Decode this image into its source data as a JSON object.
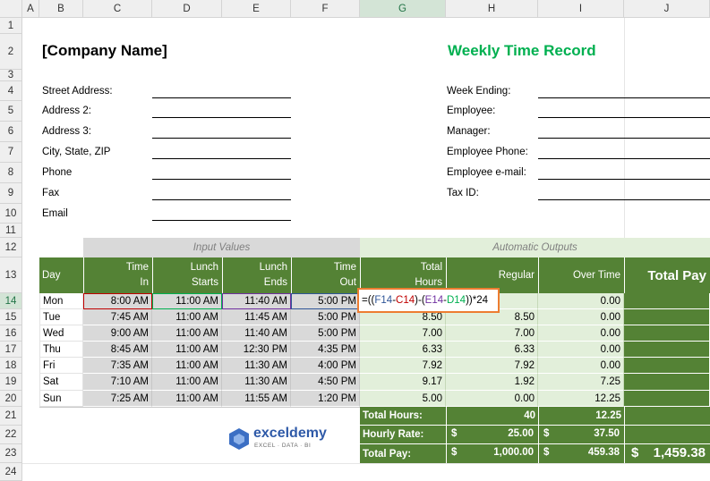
{
  "columns": [
    "A",
    "B",
    "C",
    "D",
    "E",
    "F",
    "G",
    "H",
    "I",
    "J"
  ],
  "rows": [
    "1",
    "2",
    "3",
    "4",
    "5",
    "6",
    "7",
    "8",
    "9",
    "10",
    "11",
    "12",
    "13",
    "14",
    "15",
    "16",
    "17",
    "18",
    "19",
    "20",
    "21",
    "22",
    "23",
    "24"
  ],
  "header": {
    "company": "[Company Name]",
    "title": "Weekly Time Record"
  },
  "left_labels": [
    "Street Address:",
    "Address 2:",
    "Address 3:",
    "City, State, ZIP",
    "Phone",
    "Fax",
    "Email"
  ],
  "right_labels": [
    "Week Ending:",
    "Employee:",
    "Manager:",
    "Employee Phone:",
    "Employee e-mail:",
    "Tax ID:"
  ],
  "section": {
    "input_values": "Input Values",
    "automatic_outputs": "Automatic Outputs"
  },
  "table_headers": {
    "day": "Day",
    "time_in": [
      "Time",
      "In"
    ],
    "lunch_starts": [
      "Lunch",
      "Starts"
    ],
    "lunch_ends": [
      "Lunch",
      "Ends"
    ],
    "time_out": [
      "Time",
      "Out"
    ],
    "total_hours": [
      "Total",
      "Hours"
    ],
    "regular": "Regular",
    "over_time": "Over Time",
    "total_pay": "Total Pay"
  },
  "days": [
    {
      "day": "Mon",
      "in": "8:00 AM",
      "ls": "11:00 AM",
      "le": "11:40 AM",
      "out": "5:00 PM",
      "total": "",
      "regular": "",
      "ot": "0.00"
    },
    {
      "day": "Tue",
      "in": "7:45 AM",
      "ls": "11:00 AM",
      "le": "11:45 AM",
      "out": "5:00 PM",
      "total": "8.50",
      "regular": "8.50",
      "ot": "0.00"
    },
    {
      "day": "Wed",
      "in": "9:00 AM",
      "ls": "11:00 AM",
      "le": "11:40 AM",
      "out": "5:00 PM",
      "total": "7.00",
      "regular": "7.00",
      "ot": "0.00"
    },
    {
      "day": "Thu",
      "in": "8:45 AM",
      "ls": "11:00 AM",
      "le": "12:30 PM",
      "out": "4:35 PM",
      "total": "6.33",
      "regular": "6.33",
      "ot": "0.00"
    },
    {
      "day": "Fri",
      "in": "7:35 AM",
      "ls": "11:00 AM",
      "le": "11:30 AM",
      "out": "4:00 PM",
      "total": "7.92",
      "regular": "7.92",
      "ot": "0.00"
    },
    {
      "day": "Sat",
      "in": "7:10 AM",
      "ls": "11:00 AM",
      "le": "11:30 AM",
      "out": "4:50 PM",
      "total": "9.17",
      "regular": "1.92",
      "ot": "7.25"
    },
    {
      "day": "Sun",
      "in": "7:25 AM",
      "ls": "11:00 AM",
      "le": "11:55 AM",
      "out": "1:20 PM",
      "total": "5.00",
      "regular": "0.00",
      "ot": "12.25"
    }
  ],
  "formula": {
    "eq": "=((",
    "f14": "F14",
    "m1": "-",
    "c14": "C14",
    "mid": ")-(",
    "e14": "E14",
    "m2": "-",
    "d14": "D14",
    "tail": "))*24"
  },
  "summary": {
    "total_hours_label": "Total Hours:",
    "total_hours_regular": "40",
    "total_hours_ot": "12.25",
    "hourly_rate_label": "Hourly Rate:",
    "currency": "$",
    "rate_regular": "25.00",
    "rate_ot": "37.50",
    "total_pay_label": "Total Pay:",
    "pay_regular": "1,000.00",
    "pay_ot": "459.38",
    "grand_total": "1,459.38"
  },
  "watermark": {
    "name": "exceldemy",
    "tagline": "EXCEL · DATA · BI"
  },
  "colors": {
    "title_green": "#00b050",
    "header_green": "#548235",
    "light_green": "#e2efda",
    "input_gray": "#d9d9d9",
    "highlight_orange": "#ed7d31",
    "ref_red": "#c00000",
    "ref_blue": "#2f5597",
    "ref_purple": "#7030a0",
    "ref_green": "#00b050"
  }
}
